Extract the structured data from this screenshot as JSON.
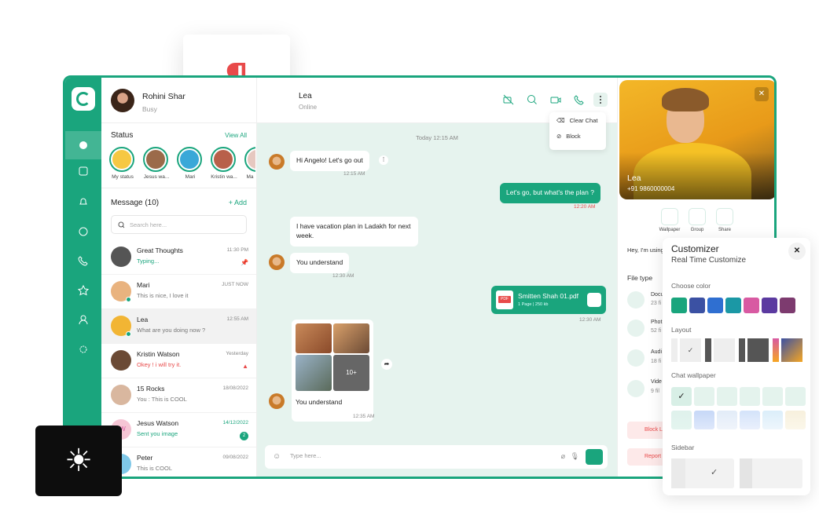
{
  "user": {
    "name": "Rohini Shar",
    "status": "Busy"
  },
  "status_section": {
    "title": "Status",
    "view_all": "View All",
    "stories": [
      {
        "label": "My status"
      },
      {
        "label": "Jesus wa..."
      },
      {
        "label": "Mari"
      },
      {
        "label": "Kristin wa..."
      },
      {
        "label": "Ma"
      }
    ]
  },
  "messages_section": {
    "title": "Message (10)",
    "add": "+ Add",
    "search_placeholder": "Search here...",
    "chats": [
      {
        "name": "Great Thoughts",
        "msg": "Typing...",
        "time": "11:30 PM"
      },
      {
        "name": "Mari",
        "msg": "This is nice, I love it",
        "time": "JUST NOW"
      },
      {
        "name": "Lea",
        "msg": "What are you doing now ?",
        "time": "12:55 AM"
      },
      {
        "name": "Kristin Watson",
        "msg": "Okey ! i will try it.",
        "time": "Yesterday"
      },
      {
        "name": "15 Rocks",
        "msg": "You : This is COOL",
        "time": "18/08/2022"
      },
      {
        "name": "Jesus Watson",
        "msg": "Sent you image",
        "time": "14/12/2022",
        "badge": "2",
        "initials": "JW"
      },
      {
        "name": "Peter",
        "msg": "This is COOL",
        "time": "09/08/2022"
      }
    ]
  },
  "conversation": {
    "name": "Lea",
    "status": "Online",
    "menu": [
      "Clear Chat",
      "Block"
    ],
    "date": "Today 12:15 AM",
    "m1": "Hi Angelo! Let's go out",
    "t1": "12:15 AM",
    "m2": "Let's go, but what's the plan ?",
    "t2": "12:20 AM",
    "m3": "I have vacation plan in Ladakh for next week.",
    "m4": "You understand",
    "t4": "12:30 AM",
    "pdf_name": "Smitten Shah 01.pdf",
    "pdf_meta": "1 Page | 250 kb",
    "pdf_label": "PDF",
    "t5": "12:30 AM",
    "img_more": "10+",
    "m6": "You understand",
    "t6": "12:35 AM",
    "composer_placeholder": "Type here..."
  },
  "profile": {
    "name": "Lea",
    "phone": "+91 9860000004",
    "actions": [
      "Wallpaper",
      "Group",
      "Share"
    ],
    "about": "Hey, I'm using",
    "file_type_title": "File type",
    "files": [
      {
        "label": "Docu",
        "count": "23 fi"
      },
      {
        "label": "Phot",
        "count": "52 fi"
      },
      {
        "label": "Audi",
        "count": "18 fi"
      },
      {
        "label": "Vide",
        "count": "9 fil"
      }
    ],
    "block": "Block L",
    "report": "Report"
  },
  "customizer": {
    "title": "Customizer",
    "subtitle": "Real Time Customize",
    "choose_color": "Choose color",
    "colors": [
      "#1aa57d",
      "#3b51a3",
      "#2f6fd1",
      "#1b98a5",
      "#d85aa2",
      "#5b3aa0",
      "#7d3b6f"
    ],
    "layout": "Layout",
    "chat_wallpaper": "Chat wallpaper",
    "sidebar": "Sidebar"
  },
  "accent": "#1aa57d"
}
